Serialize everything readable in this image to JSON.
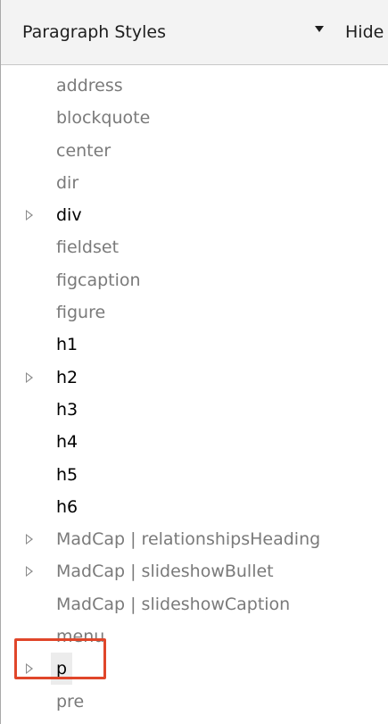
{
  "toolbar": {
    "style_type_selected": "Paragraph Styles",
    "hide_label": "Hide"
  },
  "styles": [
    {
      "label": "address",
      "used": false,
      "expandable": false
    },
    {
      "label": "blockquote",
      "used": false,
      "expandable": false
    },
    {
      "label": "center",
      "used": false,
      "expandable": false
    },
    {
      "label": "dir",
      "used": false,
      "expandable": false
    },
    {
      "label": "div",
      "used": true,
      "expandable": true
    },
    {
      "label": "fieldset",
      "used": false,
      "expandable": false
    },
    {
      "label": "figcaption",
      "used": false,
      "expandable": false
    },
    {
      "label": "figure",
      "used": false,
      "expandable": false
    },
    {
      "label": "h1",
      "used": true,
      "expandable": false
    },
    {
      "label": "h2",
      "used": true,
      "expandable": true
    },
    {
      "label": "h3",
      "used": true,
      "expandable": false
    },
    {
      "label": "h4",
      "used": true,
      "expandable": false
    },
    {
      "label": "h5",
      "used": true,
      "expandable": false
    },
    {
      "label": "h6",
      "used": true,
      "expandable": false
    },
    {
      "label": "MadCap | relationshipsHeading",
      "used": false,
      "expandable": true
    },
    {
      "label": "MadCap | slideshowBullet",
      "used": false,
      "expandable": true
    },
    {
      "label": "MadCap | slideshowCaption",
      "used": false,
      "expandable": false
    },
    {
      "label": "menu",
      "used": false,
      "expandable": false
    },
    {
      "label": "p",
      "used": true,
      "expandable": true,
      "selected": true
    },
    {
      "label": "pre",
      "used": false,
      "expandable": false
    }
  ],
  "colors": {
    "used_style": "#000000",
    "unused_style": "#7a7a7a",
    "highlight_box": "#e0462a"
  }
}
